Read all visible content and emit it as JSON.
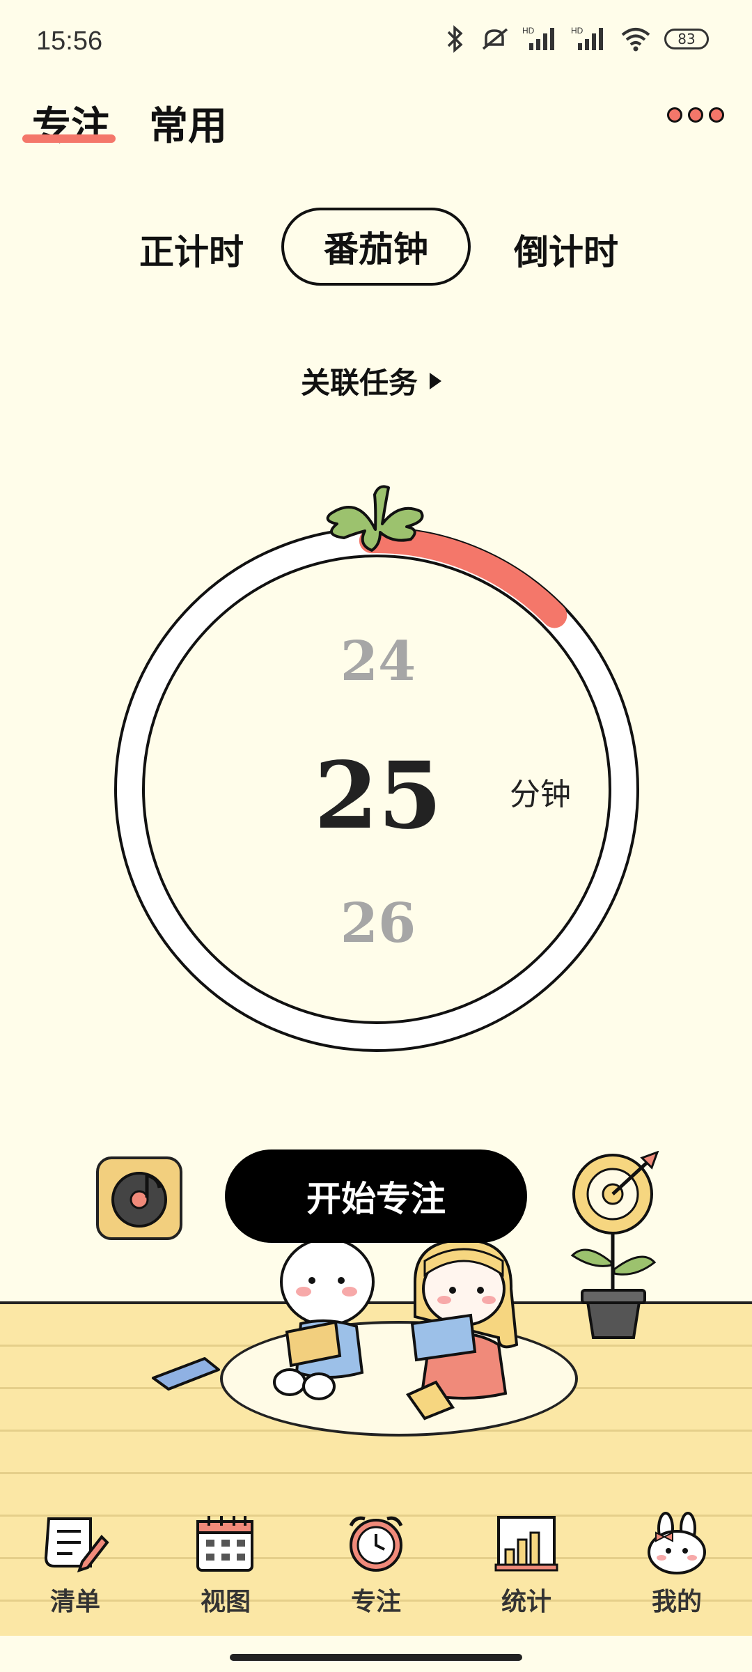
{
  "status_bar": {
    "time": "15:56",
    "battery": "83"
  },
  "header": {
    "tabs": [
      {
        "label": "专注"
      },
      {
        "label": "常用"
      }
    ]
  },
  "modes": [
    {
      "label": "正计时"
    },
    {
      "label": "番茄钟"
    },
    {
      "label": "倒计时"
    }
  ],
  "linked_task": {
    "label": "关联任务"
  },
  "timer": {
    "prev": "24",
    "value": "25",
    "next": "26",
    "unit": "分钟",
    "progress_fraction": 0.13
  },
  "start_button": {
    "label": "开始专注"
  },
  "nav": [
    {
      "label": "清单",
      "icon": "checklist-icon"
    },
    {
      "label": "视图",
      "icon": "calendar-icon"
    },
    {
      "label": "专注",
      "icon": "alarm-clock-icon"
    },
    {
      "label": "统计",
      "icon": "bar-chart-icon"
    },
    {
      "label": "我的",
      "icon": "bunny-icon"
    }
  ],
  "colors": {
    "background": "#fffdea",
    "accent": "#f4776a",
    "leaf": "#9cc26e",
    "floor": "#fbe7a5"
  }
}
